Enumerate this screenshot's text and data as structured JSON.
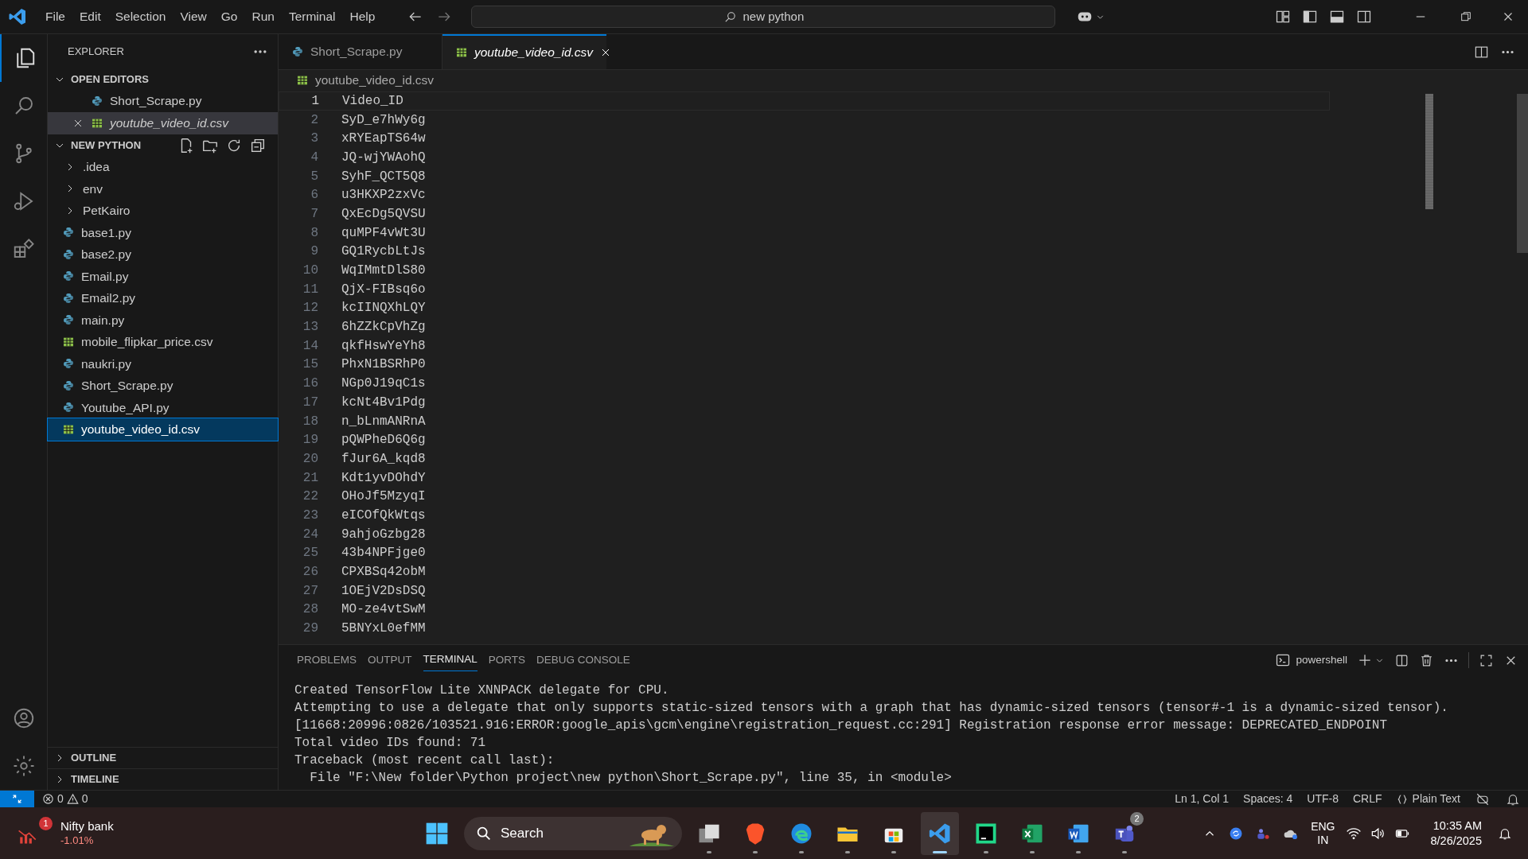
{
  "menu": [
    "File",
    "Edit",
    "Selection",
    "View",
    "Go",
    "Run",
    "Terminal",
    "Help"
  ],
  "command_center": {
    "text": "new python"
  },
  "sidebar": {
    "title": "EXPLORER",
    "open_editors": {
      "label": "OPEN EDITORS",
      "expanded": true,
      "items": [
        {
          "name": "Short_Scrape.py",
          "kind": "py",
          "selected": false,
          "preview": false
        },
        {
          "name": "youtube_video_id.csv",
          "kind": "csv",
          "selected": true,
          "preview": true
        }
      ]
    },
    "folder": {
      "label": "NEW PYTHON",
      "expanded": true,
      "items": [
        {
          "name": ".idea",
          "kind": "folder",
          "selected": false
        },
        {
          "name": "env",
          "kind": "folder",
          "selected": false
        },
        {
          "name": "PetKairo",
          "kind": "folder",
          "selected": false
        },
        {
          "name": "base1.py",
          "kind": "py",
          "selected": false
        },
        {
          "name": "base2.py",
          "kind": "py",
          "selected": false
        },
        {
          "name": "Email.py",
          "kind": "py",
          "selected": false
        },
        {
          "name": "Email2.py",
          "kind": "py",
          "selected": false
        },
        {
          "name": "main.py",
          "kind": "py",
          "selected": false
        },
        {
          "name": "mobile_flipkar_price.csv",
          "kind": "csv",
          "selected": false
        },
        {
          "name": "naukri.py",
          "kind": "py",
          "selected": false
        },
        {
          "name": "Short_Scrape.py",
          "kind": "py",
          "selected": false
        },
        {
          "name": "Youtube_API.py",
          "kind": "py",
          "selected": false
        },
        {
          "name": "youtube_video_id.csv",
          "kind": "csv",
          "selected": true
        }
      ]
    },
    "sections": [
      {
        "label": "OUTLINE",
        "expanded": false
      },
      {
        "label": "TIMELINE",
        "expanded": false
      }
    ]
  },
  "tabs": [
    {
      "label": "Short_Scrape.py",
      "kind": "py",
      "selected": false,
      "preview": false
    },
    {
      "label": "youtube_video_id.csv",
      "kind": "csv",
      "selected": true,
      "preview": true
    }
  ],
  "breadcrumb": "youtube_video_id.csv",
  "editor": {
    "lines": [
      {
        "number": "1",
        "text": "Video_ID"
      },
      {
        "number": "2",
        "text": "SyD_e7hWy6g"
      },
      {
        "number": "3",
        "text": "xRYEapTS64w"
      },
      {
        "number": "4",
        "text": "JQ-wjYWAohQ"
      },
      {
        "number": "5",
        "text": "SyhF_QCT5Q8"
      },
      {
        "number": "6",
        "text": "u3HKXP2zxVc"
      },
      {
        "number": "7",
        "text": "QxEcDg5QVSU"
      },
      {
        "number": "8",
        "text": "quMPF4vWt3U"
      },
      {
        "number": "9",
        "text": "GQ1RycbLtJs"
      },
      {
        "number": "10",
        "text": "WqIMmtDlS80"
      },
      {
        "number": "11",
        "text": "QjX-FIBsq6o"
      },
      {
        "number": "12",
        "text": "kcIINQXhLQY"
      },
      {
        "number": "13",
        "text": "6hZZkCpVhZg"
      },
      {
        "number": "14",
        "text": "qkfHswYeYh8"
      },
      {
        "number": "15",
        "text": "PhxN1BSRhP0"
      },
      {
        "number": "16",
        "text": "NGp0J19qC1s"
      },
      {
        "number": "17",
        "text": "kcNt4Bv1Pdg"
      },
      {
        "number": "18",
        "text": "n_bLnmANRnA"
      },
      {
        "number": "19",
        "text": "pQWPheD6Q6g"
      },
      {
        "number": "20",
        "text": "fJur6A_kqd8"
      },
      {
        "number": "21",
        "text": "Kdt1yvDOhdY"
      },
      {
        "number": "22",
        "text": "OHoJf5MzyqI"
      },
      {
        "number": "23",
        "text": "eICOfQkWtqs"
      },
      {
        "number": "24",
        "text": "9ahjoGzbg28"
      },
      {
        "number": "25",
        "text": "43b4NPFjge0"
      },
      {
        "number": "26",
        "text": "CPXBSq42obM"
      },
      {
        "number": "27",
        "text": "1OEjV2DsDSQ"
      },
      {
        "number": "28",
        "text": "MO-ze4vtSwM"
      },
      {
        "number": "29",
        "text": "5BNYxL0efMM"
      }
    ]
  },
  "panel": {
    "tabs": [
      {
        "label": "PROBLEMS",
        "selected": false
      },
      {
        "label": "OUTPUT",
        "selected": false
      },
      {
        "label": "TERMINAL",
        "selected": true
      },
      {
        "label": "PORTS",
        "selected": false
      },
      {
        "label": "DEBUG CONSOLE",
        "selected": false
      }
    ],
    "shell": "powershell",
    "terminal_lines": [
      "Created TensorFlow Lite XNNPACK delegate for CPU.",
      "Attempting to use a delegate that only supports static-sized tensors with a graph that has dynamic-sized tensors (tensor#-1 is a dynamic-sized tensor).",
      "[11668:20996:0826/103521.916:ERROR:google_apis\\gcm\\engine\\registration_request.cc:291] Registration response error message: DEPRECATED_ENDPOINT",
      "Total video IDs found: 71",
      "Traceback (most recent call last):",
      "  File \"F:\\New folder\\Python project\\new python\\Short_Scrape.py\", line 35, in <module>"
    ]
  },
  "status_bar": {
    "errors": "0",
    "warnings": "0",
    "items": [
      "Ln 1, Col 1",
      "Spaces: 4",
      "UTF-8",
      "CRLF",
      "Plain Text"
    ]
  },
  "taskbar": {
    "widget": {
      "badge": "1",
      "title": "Nifty bank",
      "change": "-1.01%"
    },
    "search": "Search",
    "apps": [
      {
        "kind": "files",
        "active": false
      },
      {
        "kind": "brave",
        "active": false
      },
      {
        "kind": "edge",
        "active": false
      },
      {
        "kind": "explorer",
        "active": false
      },
      {
        "kind": "store",
        "active": false
      },
      {
        "kind": "vscode",
        "active": true
      },
      {
        "kind": "pycharm",
        "active": false
      },
      {
        "kind": "excel",
        "active": false
      },
      {
        "kind": "word",
        "active": false
      },
      {
        "kind": "teams",
        "active": false,
        "badge": "2"
      }
    ],
    "lang": [
      "ENG",
      "IN"
    ],
    "time": "10:35 AM",
    "date": "8/26/2025"
  }
}
